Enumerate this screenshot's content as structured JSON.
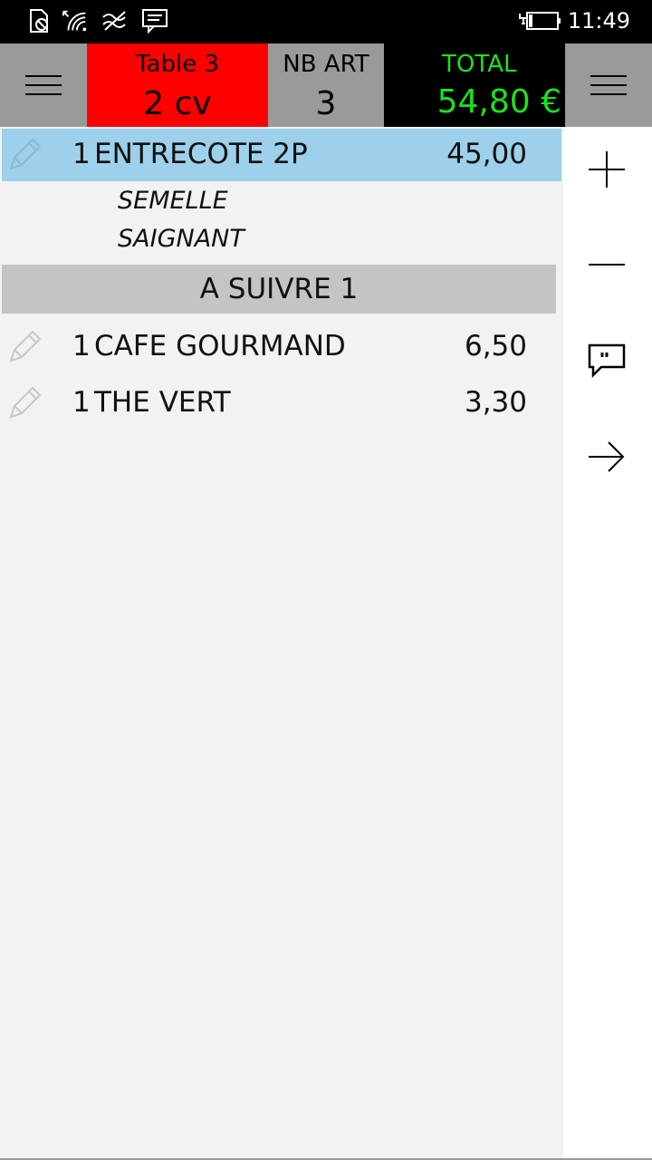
{
  "status_bar": {
    "time": "11:49",
    "icons": [
      "no-sim-icon",
      "wifi-icon",
      "network-icon",
      "message-icon",
      "battery-charging-icon"
    ]
  },
  "header": {
    "left_menu_icon": "hamburger-menu-icon",
    "right_menu_icon": "hamburger-menu-icon",
    "table_label": "Table 3",
    "covers": "2 cv",
    "nb_art_label": "NB ART",
    "nb_art_value": "3",
    "total_label": "TOTAL",
    "total_value": "54,80 €",
    "colors": {
      "table_bg": "#ff0000",
      "total_text": "#1fe01f",
      "total_bg": "#000000",
      "gray_bg": "#9a9a9a"
    }
  },
  "orders": {
    "items": [
      {
        "qty": "1",
        "name": "ENTRECOTE 2P",
        "price": "45,00",
        "selected": true,
        "modifiers": [
          "SEMELLE",
          "SAIGNANT"
        ]
      },
      {
        "qty": "1",
        "name": "CAFE GOURMAND",
        "price": "6,50",
        "selected": false,
        "modifiers": []
      },
      {
        "qty": "1",
        "name": "THE VERT",
        "price": "3,30",
        "selected": false,
        "modifiers": []
      }
    ],
    "separator_label": "A SUIVRE 1",
    "selected_color": "#9dd0ea",
    "separator_color": "#c4c4c4"
  },
  "actions": [
    {
      "icon": "plus-icon"
    },
    {
      "icon": "minus-icon"
    },
    {
      "icon": "comment-icon"
    },
    {
      "icon": "arrow-right-icon"
    }
  ]
}
